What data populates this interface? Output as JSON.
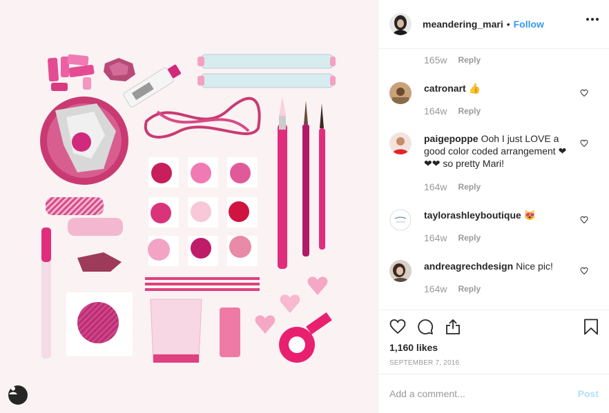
{
  "post": {
    "username": "meandering_mari",
    "separator": "•",
    "follow_label": "Follow",
    "more_icon": "more-options-icon",
    "photo_alt": "Flat lay of pink craft supplies"
  },
  "comments": {
    "top_meta": {
      "time": "165w",
      "reply": "Reply"
    },
    "items": [
      {
        "username": "catronart",
        "text": "👍",
        "time": "164w",
        "reply": "Reply"
      },
      {
        "username": "paigepoppe",
        "text": "Ooh I just LOVE a good color coded arrangement ❤❤❤ so pretty Mari!",
        "time": "164w",
        "reply": "Reply"
      },
      {
        "username": "taylorashleyboutique",
        "text": "😻",
        "time": "164w",
        "reply": "Reply"
      },
      {
        "username": "andreagrechdesign",
        "text": "Nice pic!",
        "time": "164w",
        "reply": "Reply"
      }
    ]
  },
  "actions": {
    "likes": "1,160 likes",
    "date": "September 7, 2016",
    "icons": [
      "heart-icon",
      "comment-icon",
      "share-icon",
      "bookmark-icon"
    ]
  },
  "add_comment": {
    "placeholder": "Add a comment...",
    "post_label": "Post"
  },
  "colors": {
    "accent": "#3897f0",
    "post_disabled": "#b2dffc",
    "muted": "#999999",
    "photo_bg": "#faf2f3",
    "pink": "#e6337d"
  }
}
